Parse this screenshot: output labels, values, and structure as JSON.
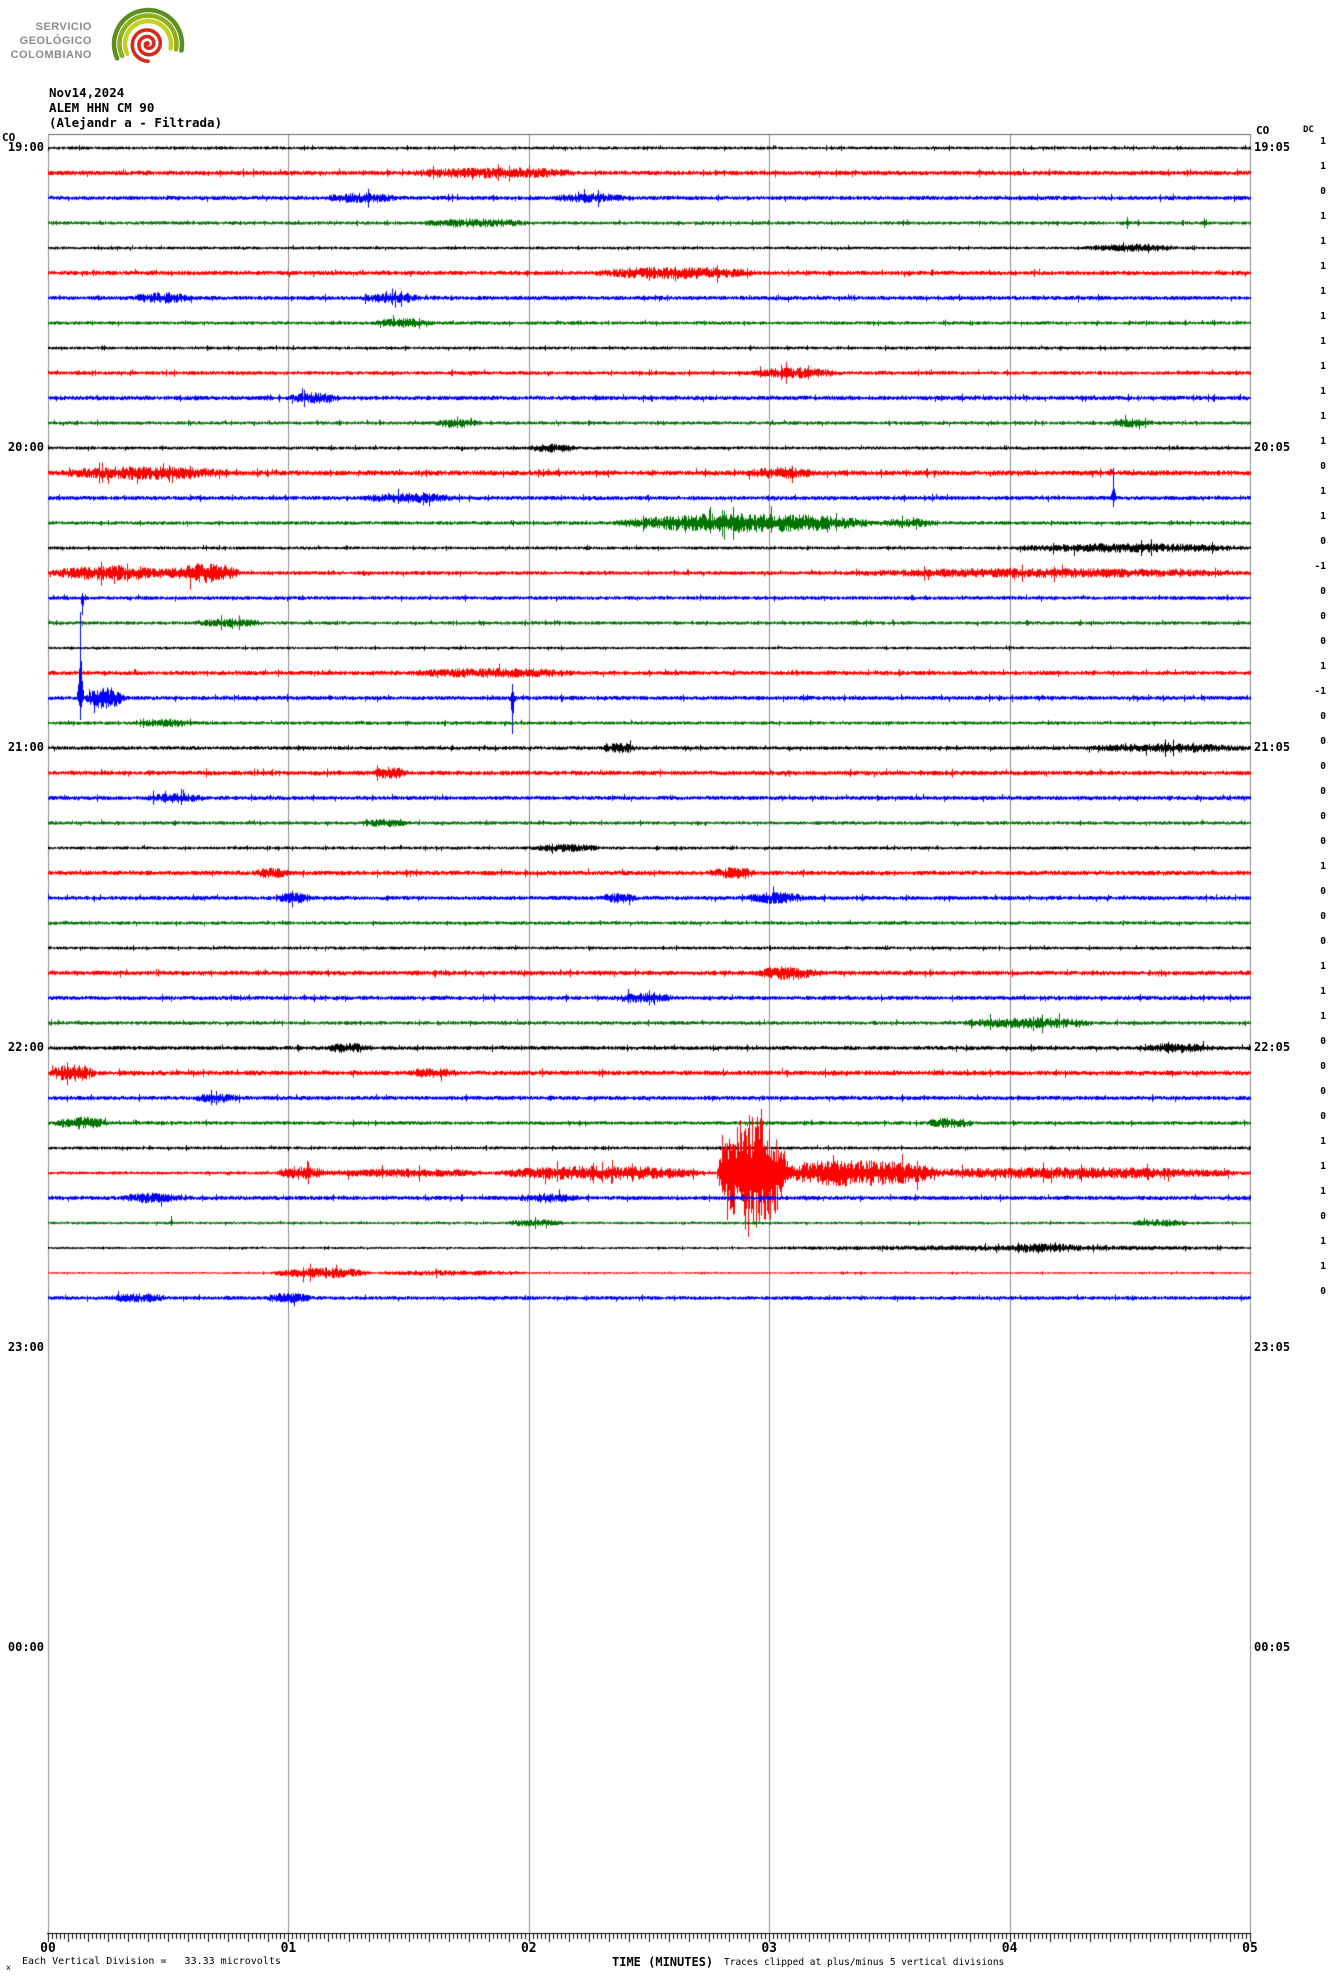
{
  "logo": {
    "lines": [
      "SERVICIO",
      "GEOLÓGICO",
      "COLOMBIANO"
    ]
  },
  "header": {
    "date": "Nov14,2024",
    "station": "ALEM HHN CM 90",
    "subtitle": "(Alejandr  a - Filtrada)"
  },
  "corner": {
    "left": "CO",
    "right": "CO",
    "dc": "DC"
  },
  "hours": [
    {
      "left": "19:00",
      "right": "19:05"
    },
    {
      "left": "20:00",
      "right": "20:05"
    },
    {
      "left": "21:00",
      "right": "21:05"
    },
    {
      "left": "22:00",
      "right": "22:05"
    },
    {
      "left": "23:00",
      "right": "23:05"
    },
    {
      "left": "00:00",
      "right": "00:05"
    }
  ],
  "axis": {
    "title": "TIME (MINUTES)",
    "ticks": [
      "00",
      "01",
      "02",
      "03",
      "04",
      "05"
    ],
    "note_marker": "x",
    "note_left": "Each Vertical Division =   33.33 microvolts",
    "note_right": "Traces clipped at plus/minus 5 vertical divisions"
  },
  "colors": {
    "black": "#000000",
    "red": "#ff0000",
    "blue": "#0000ff",
    "green": "#007400",
    "grid": "#8c8c8c",
    "border": "#666666",
    "logo_arc_outer": "#5b8f22",
    "logo_arc_mid": "#8fae1b",
    "logo_arc_inner": "#c3d021",
    "logo_spiral": "#d52b1e"
  },
  "chart_data": {
    "type": "line",
    "kind": "helicorder-seismogram",
    "station": "ALEM HHN CM 90",
    "date": "Nov14,2024",
    "minutes_per_line": 5,
    "x_range_minutes": [
      0,
      5
    ],
    "color_cycle": [
      "black",
      "red",
      "blue",
      "green"
    ],
    "vertical_division_microvolts": 33.33,
    "clip_divisions": 5,
    "traces": [
      {
        "t": "19:00",
        "dc": 1,
        "base": 1.6,
        "bursts": []
      },
      {
        "t": "19:05",
        "dc": 1,
        "base": 2.4,
        "bursts": [
          [
            1.5,
            2.2,
            3.5
          ]
        ]
      },
      {
        "t": "19:10",
        "dc": 0,
        "base": 2.2,
        "bursts": [
          [
            1.15,
            1.45,
            3.2
          ],
          [
            2.1,
            2.4,
            3.0
          ]
        ]
      },
      {
        "t": "19:15",
        "dc": 1,
        "base": 1.8,
        "bursts": [
          [
            1.55,
            2.0,
            3.0
          ]
        ],
        "spikes": [
          [
            4.49,
            6,
            6
          ],
          [
            4.81,
            5,
            5
          ]
        ]
      },
      {
        "t": "19:20",
        "dc": 1,
        "base": 1.5,
        "bursts": [
          [
            4.3,
            4.7,
            2.5
          ]
        ]
      },
      {
        "t": "19:25",
        "dc": 1,
        "base": 2.3,
        "bursts": [
          [
            2.27,
            2.95,
            4.0
          ]
        ]
      },
      {
        "t": "19:30",
        "dc": 1,
        "base": 2.2,
        "bursts": [
          [
            0.35,
            0.6,
            3.5
          ],
          [
            1.3,
            1.55,
            3.0
          ]
        ]
      },
      {
        "t": "19:35",
        "dc": 1,
        "base": 1.8,
        "bursts": [
          [
            1.35,
            1.6,
            3.0
          ]
        ]
      },
      {
        "t": "19:40",
        "dc": 1,
        "base": 1.6,
        "bursts": []
      },
      {
        "t": "19:45",
        "dc": 1,
        "base": 2.0,
        "bursts": [
          [
            2.9,
            3.3,
            3.5
          ]
        ],
        "spikes": [
          [
            3.07,
            11,
            11
          ]
        ]
      },
      {
        "t": "19:50",
        "dc": 1,
        "base": 2.3,
        "bursts": [
          [
            1.0,
            1.2,
            3.5
          ]
        ]
      },
      {
        "t": "19:55",
        "dc": 1,
        "base": 1.8,
        "bursts": [
          [
            1.6,
            1.8,
            3.0
          ],
          [
            4.4,
            4.6,
            3.0
          ]
        ]
      },
      {
        "t": "20:00",
        "dc": 1,
        "base": 1.7,
        "bursts": [
          [
            2.0,
            2.2,
            3.0
          ]
        ]
      },
      {
        "t": "20:05",
        "dc": 0,
        "base": 2.6,
        "bursts": [
          [
            0.05,
            0.75,
            4.5
          ],
          [
            2.9,
            3.2,
            3.5
          ]
        ]
      },
      {
        "t": "20:10",
        "dc": 1,
        "base": 2.2,
        "bursts": [
          [
            1.3,
            1.7,
            3.2
          ]
        ],
        "spikes": [
          [
            4.43,
            30,
            9
          ]
        ]
      },
      {
        "t": "20:15",
        "dc": 1,
        "base": 1.9,
        "bursts": [
          [
            2.35,
            3.45,
            8.0
          ],
          [
            3.45,
            3.7,
            3.0
          ]
        ]
      },
      {
        "t": "20:20",
        "dc": 0,
        "base": 1.6,
        "bursts": [
          [
            4.0,
            5.0,
            3.2
          ]
        ]
      },
      {
        "t": "20:25",
        "dc": -1,
        "base": 2.0,
        "bursts": [
          [
            0.0,
            0.55,
            6.0
          ],
          [
            0.5,
            0.8,
            8.0
          ],
          [
            3.3,
            5.0,
            3.0
          ]
        ]
      },
      {
        "t": "20:30",
        "dc": 0,
        "base": 2.0,
        "bursts": [],
        "spikes": [
          [
            0.14,
            5,
            17
          ]
        ]
      },
      {
        "t": "20:35",
        "dc": 0,
        "base": 1.8,
        "bursts": [
          [
            0.6,
            0.9,
            2.8
          ]
        ]
      },
      {
        "t": "20:40",
        "dc": 0,
        "base": 1.4,
        "bursts": []
      },
      {
        "t": "20:45",
        "dc": 1,
        "base": 2.2,
        "bursts": [
          [
            1.5,
            2.2,
            3.0
          ]
        ]
      },
      {
        "t": "20:50",
        "dc": -1,
        "base": 2.2,
        "bursts": [
          [
            0.15,
            0.32,
            9.0
          ]
        ],
        "spikes": [
          [
            0.133,
            86,
            22
          ],
          [
            1.93,
            14,
            36
          ]
        ]
      },
      {
        "t": "20:55",
        "dc": 0,
        "base": 1.8,
        "bursts": [
          [
            0.38,
            0.6,
            2.8
          ]
        ]
      },
      {
        "t": "21:00",
        "dc": 0,
        "base": 1.9,
        "bursts": [
          [
            2.3,
            2.45,
            3.5
          ],
          [
            4.3,
            5.0,
            2.8
          ]
        ]
      },
      {
        "t": "21:05",
        "dc": 0,
        "base": 2.4,
        "bursts": [
          [
            1.35,
            1.5,
            4.0
          ]
        ]
      },
      {
        "t": "21:10",
        "dc": 0,
        "base": 2.2,
        "bursts": [
          [
            0.4,
            0.65,
            3.0
          ]
        ]
      },
      {
        "t": "21:15",
        "dc": 0,
        "base": 1.8,
        "bursts": [
          [
            1.3,
            1.5,
            2.8
          ]
        ]
      },
      {
        "t": "21:20",
        "dc": 0,
        "base": 1.6,
        "bursts": [
          [
            2.0,
            2.3,
            2.6
          ]
        ]
      },
      {
        "t": "21:25",
        "dc": 1,
        "base": 2.4,
        "bursts": [
          [
            0.85,
            1.0,
            3.5
          ],
          [
            2.75,
            2.95,
            3.5
          ]
        ]
      },
      {
        "t": "21:30",
        "dc": 0,
        "base": 2.2,
        "bursts": [
          [
            0.95,
            1.1,
            3.6
          ],
          [
            2.3,
            2.45,
            3.3
          ],
          [
            2.9,
            3.15,
            4.0
          ]
        ]
      },
      {
        "t": "21:35",
        "dc": 0,
        "base": 1.8,
        "bursts": []
      },
      {
        "t": "21:40",
        "dc": 0,
        "base": 1.6,
        "bursts": []
      },
      {
        "t": "21:45",
        "dc": 1,
        "base": 2.4,
        "bursts": [
          [
            2.95,
            3.2,
            5.0
          ]
        ]
      },
      {
        "t": "21:50",
        "dc": 1,
        "base": 2.2,
        "bursts": [
          [
            2.35,
            2.6,
            3.2
          ]
        ]
      },
      {
        "t": "21:55",
        "dc": 1,
        "base": 1.9,
        "bursts": [
          [
            3.8,
            4.35,
            4.0
          ]
        ]
      },
      {
        "t": "22:00",
        "dc": 0,
        "base": 2.1,
        "bursts": [
          [
            1.15,
            1.35,
            3.2
          ],
          [
            4.55,
            4.85,
            3.0
          ]
        ]
      },
      {
        "t": "22:05",
        "dc": 0,
        "base": 2.5,
        "bursts": [
          [
            0.0,
            0.2,
            6.0
          ],
          [
            1.5,
            1.7,
            3.0
          ]
        ]
      },
      {
        "t": "22:10",
        "dc": 0,
        "base": 2.2,
        "bursts": [
          [
            0.6,
            0.8,
            3.0
          ]
        ],
        "spikes": [
          [
            0.7,
            7,
            7
          ]
        ]
      },
      {
        "t": "22:15",
        "dc": 0,
        "base": 1.9,
        "bursts": [
          [
            0.03,
            0.25,
            4.5
          ],
          [
            3.65,
            3.85,
            3.6
          ]
        ]
      },
      {
        "t": "22:20",
        "dc": 1,
        "base": 1.6,
        "bursts": []
      },
      {
        "t": "22:25",
        "dc": 1,
        "base": 1.6,
        "bursts": [
          [
            0.95,
            1.15,
            5.5
          ],
          [
            1.1,
            1.85,
            3.0
          ],
          [
            1.85,
            2.75,
            6.0
          ],
          [
            2.78,
            3.08,
            58.0
          ],
          [
            3.0,
            3.7,
            12.0
          ],
          [
            3.5,
            5.0,
            4.5
          ]
        ]
      },
      {
        "t": "22:30",
        "dc": 1,
        "base": 2.2,
        "bursts": [
          [
            0.3,
            0.55,
            3.2
          ],
          [
            1.95,
            2.2,
            3.0
          ]
        ]
      },
      {
        "t": "22:35",
        "dc": 0,
        "base": 1.4,
        "bursts": [
          [
            1.9,
            2.15,
            2.4
          ],
          [
            4.5,
            4.75,
            2.6
          ]
        ],
        "spikes": [
          [
            0.51,
            7,
            3
          ]
        ]
      },
      {
        "t": "22:40",
        "dc": 1,
        "base": 1.2,
        "bursts": [
          [
            3.0,
            5.0,
            1.5
          ],
          [
            4.0,
            4.3,
            2.2
          ]
        ]
      },
      {
        "t": "22:45",
        "dc": 1,
        "base": 1.0,
        "bursts": [
          [
            0.92,
            1.35,
            4.5
          ],
          [
            1.35,
            2.0,
            2.0
          ]
        ]
      },
      {
        "t": "22:50",
        "dc": 0,
        "base": 2.0,
        "bursts": [
          [
            0.25,
            0.5,
            3.0
          ],
          [
            0.9,
            1.1,
            3.4
          ]
        ]
      }
    ]
  }
}
